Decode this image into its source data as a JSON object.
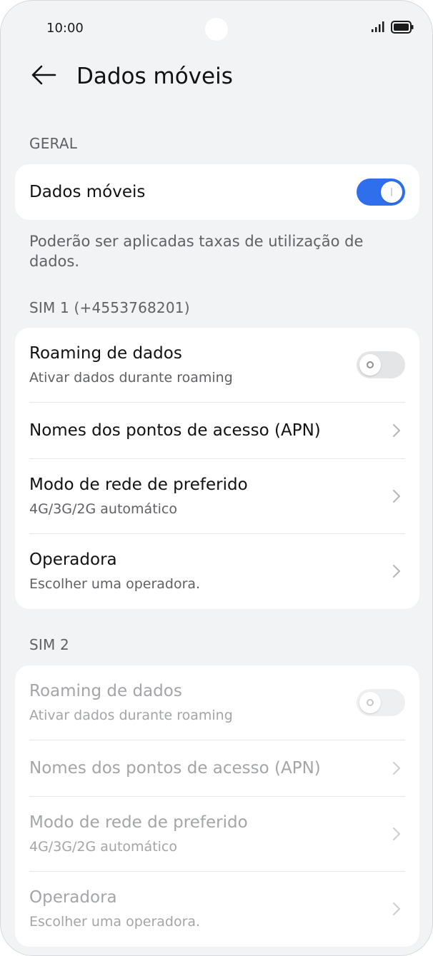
{
  "status_bar": {
    "time": "10:00"
  },
  "header": {
    "title": "Dados móveis"
  },
  "general": {
    "section_label": "GERAL",
    "mobile_data": {
      "title": "Dados móveis",
      "enabled": true
    },
    "note": "Poderão ser aplicadas taxas de utilização de dados."
  },
  "sim1": {
    "section_label": "SIM 1 (+4553768201)",
    "roaming": {
      "title": "Roaming de dados",
      "subtitle": "Ativar dados durante roaming",
      "enabled": false
    },
    "apn": {
      "title": "Nomes dos pontos de acesso (APN)"
    },
    "network_mode": {
      "title": "Modo de rede de preferido",
      "subtitle": "4G/3G/2G automático"
    },
    "operator": {
      "title": "Operadora",
      "subtitle": "Escolher uma operadora."
    }
  },
  "sim2": {
    "section_label": "SIM 2",
    "roaming": {
      "title": "Roaming de dados",
      "subtitle": "Ativar dados durante roaming",
      "enabled": false
    },
    "apn": {
      "title": "Nomes dos pontos de acesso (APN)"
    },
    "network_mode": {
      "title": "Modo de rede de preferido",
      "subtitle": "4G/3G/2G automático"
    },
    "operator": {
      "title": "Operadora",
      "subtitle": "Escolher uma operadora."
    }
  },
  "colors": {
    "accent": "#2f6fec",
    "background": "#f1f3f5",
    "card": "#ffffff",
    "disabled_text": "#a3a5a8"
  },
  "icons": {
    "back": "arrow-left-icon",
    "chevron": "chevron-right-icon",
    "signal": "signal-icon",
    "battery": "battery-icon"
  }
}
